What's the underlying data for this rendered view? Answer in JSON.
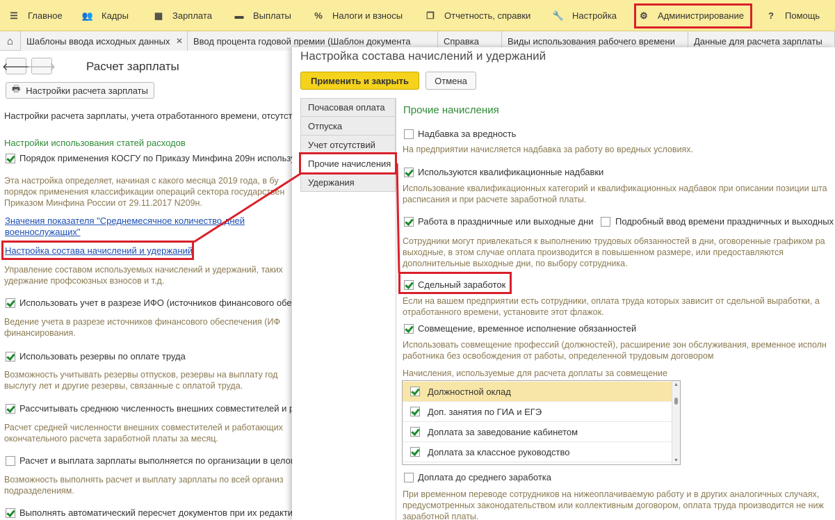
{
  "menu": {
    "items": [
      {
        "label": "Главное",
        "icon": "menu-lines-icon"
      },
      {
        "label": "Кадры",
        "icon": "people-icon"
      },
      {
        "label": "Зарплата",
        "icon": "calculator-icon"
      },
      {
        "label": "Выплаты",
        "icon": "wallet-icon"
      },
      {
        "label": "Налоги и взносы",
        "icon": "percent-icon"
      },
      {
        "label": "Отчетность, справки",
        "icon": "report-icon"
      },
      {
        "label": "Настройка",
        "icon": "wrench-icon"
      },
      {
        "label": "Администрирование",
        "icon": "gear-icon"
      },
      {
        "label": "Помощь",
        "icon": "question-icon"
      }
    ]
  },
  "tabs": [
    {
      "label": "Шаблоны ввода исходных данных"
    },
    {
      "label": "Ввод процента годовой премии (Шаблон документа"
    },
    {
      "label": "Справка"
    },
    {
      "label": "Виды использования рабочего времени"
    },
    {
      "label": "Данные для расчета зарплаты"
    }
  ],
  "left": {
    "title": "Расчет зарплаты",
    "settings_button": "Настройки расчета зарплаты",
    "intro": "Настройки расчета зарплаты, учета отработанного времени, отсутствий",
    "section": "Настройки использования статей расходов",
    "kosgu": "Порядок применения КОСГУ по Приказу Минфина 209н использу",
    "kosgu_desc1": "Эта настройка определяет, начиная с какого месяца 2019 года, в бу",
    "kosgu_desc2": "порядок применения классификации операций сектора государствен",
    "kosgu_desc3": "Приказом Минфина России от 29.11.2017 N209н.",
    "link_avg1": "Значения показателя \"Среднемесячное количество дней",
    "link_avg2": "военнослужащих\"",
    "link_setup": "Настройка состава начислений и удержаний",
    "setup_desc1": "Управление составом используемых начислений и удержаний, таких",
    "setup_desc2": "удержание профсоюзных взносов и т.д.",
    "ifo": "Использовать учет в разрезе ИФО (источников финансового обес",
    "ifo_desc1": "Ведение учета в разрезе источников финансового обеспечения (ИФ",
    "ifo_desc2": "финансирования.",
    "reserves": "Использовать резервы по оплате труда",
    "reserves_desc1": "Возможность учитывать резервы отпусков,  резервы на выплату год",
    "reserves_desc2": "выслугу лет и другие резервы, связанные с оплатой труда.",
    "avgcount": "Рассчитывать среднюю численность внешних совместителей и р",
    "avgcount_desc1": "Расчет средней численности внешних совместителей и работающих",
    "avgcount_desc2": "окончательного расчета заработной платы за месяц.",
    "org": "Расчет и выплата зарплаты выполняется по организации в целом",
    "org_desc1": "Возможность выполнять расчет и выплату зарплаты по всей организ",
    "org_desc2": "подразделениям.",
    "recalc": "Выполнять автоматический пересчет документов при их редакти"
  },
  "modal": {
    "title": "Настройка состава начислений и удержаний",
    "apply_button": "Применить и закрыть",
    "cancel_button": "Отмена",
    "side": [
      "Почасовая оплата",
      "Отпуска",
      "Учет отсутствий",
      "Прочие начисления",
      "Удержания"
    ],
    "heading": "Прочие начисления",
    "harm": "Надбавка за вредность",
    "harm_desc": "На предприятии начисляется надбавка за работу во вредных условиях.",
    "qual": "Используются квалификационные надбавки",
    "qual_desc1": "Использование квалификационных категорий и квалификационных надбавок при описании позиции шта",
    "qual_desc2": "расписания и при расчете заработной платы.",
    "holiday": "Работа в праздничные или выходные дни",
    "holiday_detail": "Подробный ввод времени праздничных и выходных",
    "holiday_desc1": "Сотрудники могут привлекаться к выполнению трудовых обязанностей в дни, оговоренные графиком ра",
    "holiday_desc2": "выходные, в этом случае оплата производится в повышенном размере, или предоставляются",
    "holiday_desc3": "дополнительные выходные дни, по выбору сотрудника.",
    "piece": "Сдельный заработок",
    "piece_desc1": "Если на вашем предприятии есть сотрудники, оплата труда которых зависит от сдельной выработки, а",
    "piece_desc2": "отработанного времени, установите этот флажок.",
    "combo": "Совмещение, временное исполнение обязанностей",
    "combo_desc1": "Использовать совмещение профессий (должностей), расширение зон обслуживания, временное исполн",
    "combo_desc2": "работника без освобождения от работы, определенной трудовым договором",
    "list_caption": "Начисления, используемые для расчета доплаты за совмещение",
    "list": [
      "Должностной оклад",
      "Доп. занятия по ГИА и ЕГЭ",
      "Доплата за заведование кабинетом",
      "Доплата за классное руководство"
    ],
    "avg": "Доплата до среднего заработка",
    "avg_desc1": "При временном переводе сотрудников на нижеоплачиваемую работу и в других аналогичных случаях,",
    "avg_desc2": "предусмотренных законодательством или коллективным договором, оплата труда производится не ниж",
    "avg_desc3": "заработной платы."
  },
  "colors": {
    "menubar": "#fbed9e",
    "highlight": "#d9202a",
    "apply": "#f5d31c",
    "heading": "#2e8b36"
  }
}
